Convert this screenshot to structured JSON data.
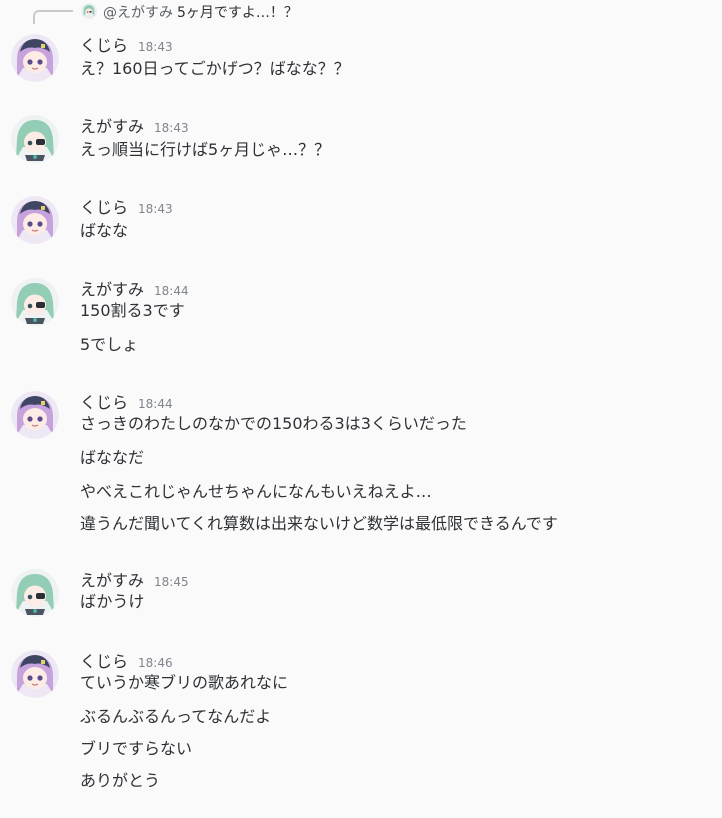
{
  "reply": {
    "mention": "@えがすみ",
    "content": "5ヶ月ですよ…！？"
  },
  "messages": [
    {
      "author": "くじら",
      "time": "18:43",
      "avatar": "kujira-avatar",
      "lines": [
        "え？160日ってごかげつ？ばなな？？"
      ]
    },
    {
      "author": "えがすみ",
      "time": "18:43",
      "avatar": "egasumi-avatar",
      "lines": [
        "えっ順当に行けば5ヶ月じゃ…？？"
      ]
    },
    {
      "author": "くじら",
      "time": "18:43",
      "avatar": "kujira-avatar",
      "lines": [
        "ばなな"
      ]
    },
    {
      "author": "えがすみ",
      "time": "18:44",
      "avatar": "egasumi-avatar",
      "lines": [
        "150割る3です",
        "5でしょ"
      ]
    },
    {
      "author": "くじら",
      "time": "18:44",
      "avatar": "kujira-avatar",
      "lines": [
        "さっきのわたしのなかでの150わる3は3くらいだった",
        "ばななだ",
        "やべえこれじゃんせちゃんになんもいえねえよ…",
        "違うんだ聞いてくれ算数は出来ないけど数学は最低限できるんです"
      ]
    },
    {
      "author": "えがすみ",
      "time": "18:45",
      "avatar": "egasumi-avatar",
      "lines": [
        "ばかうけ"
      ]
    },
    {
      "author": "くじら",
      "time": "18:46",
      "avatar": "kujira-avatar",
      "lines": [
        "ていうか寒ブリの歌あれなに",
        "ぶるんぶるんってなんだよ",
        "ブリですらない",
        "ありがとう"
      ]
    }
  ]
}
